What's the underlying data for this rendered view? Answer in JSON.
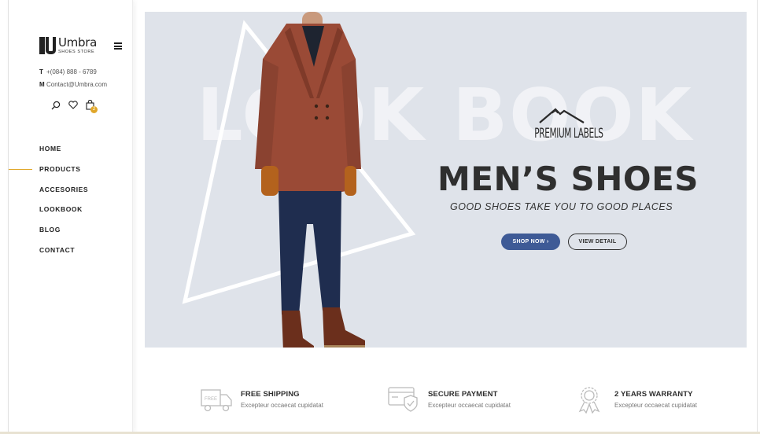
{
  "brand": {
    "name": "Umbra",
    "subtitle": "SHOES STORE"
  },
  "contact": {
    "phone_key": "T",
    "phone": "+(084) 888 - 6789",
    "mail_key": "M",
    "email": "Contact@Umbra.com"
  },
  "header_icons": {
    "search": "search-icon",
    "wishlist": "heart-icon",
    "cart": "shopping-bag-icon",
    "cart_count": "2"
  },
  "nav": {
    "items": [
      {
        "label": "HOME"
      },
      {
        "label": "PRODUCTS",
        "active": true
      },
      {
        "label": "ACCESORIES"
      },
      {
        "label": "LOOKBOOK"
      },
      {
        "label": "BLOG"
      },
      {
        "label": "CONTACT"
      }
    ]
  },
  "hero": {
    "background_text": "LOOK BOOK",
    "badge": "PREMIUM LABELS",
    "headline": "MEN’S SHOES",
    "tagline": "GOOD SHOES TAKE YOU TO GOOD PLACES",
    "shop_now_label": "SHOP NOW ›",
    "view_detail_label": "VIEW DETAIL"
  },
  "features": [
    {
      "icon": "truck-icon",
      "title": "FREE SHIPPING",
      "desc": "Excepteur occaecat cupidatat",
      "icon_text": "FREE"
    },
    {
      "icon": "credit-card-shield-icon",
      "title": "SECURE PAYMENT",
      "desc": "Excepteur occaecat cupidatat"
    },
    {
      "icon": "award-ribbon-icon",
      "title": "2 YEARS WARRANTY",
      "desc": "Excepteur occaecat cupidatat"
    }
  ],
  "colors": {
    "accent": "#e0a72a",
    "primary_button": "#3e5a96",
    "hero_background": "#dfe3ea",
    "text_dark": "#2f2f2f"
  }
}
